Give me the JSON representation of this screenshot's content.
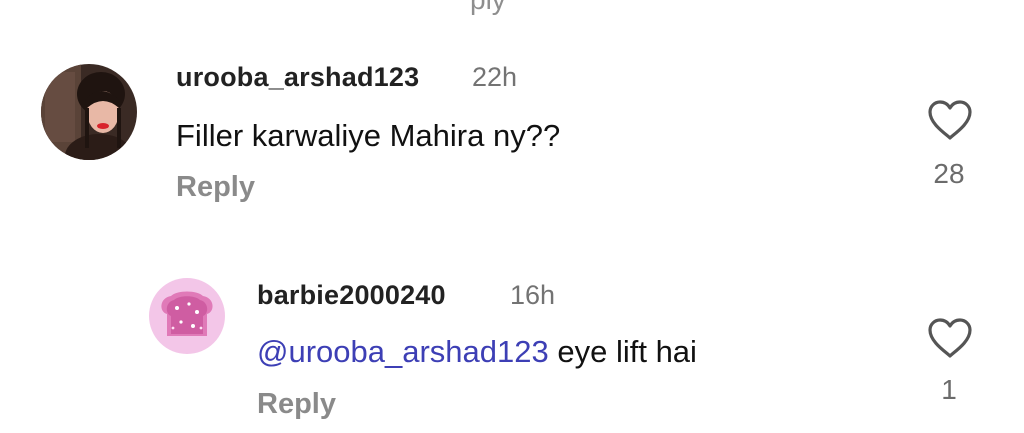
{
  "top_fragment": "ply",
  "comments": [
    {
      "username": "urooba_arshad123",
      "time": "22h",
      "text": "Filler karwaliye Mahira ny??",
      "reply_label": "Reply",
      "like_count": "28",
      "avatar_icon": "user-photo-avatar",
      "heart_icon": "heart-outline-icon"
    }
  ],
  "replies": [
    {
      "username": "barbie2000240",
      "time": "16h",
      "mention": "@urooba_arshad123",
      "text": " eye lift hai",
      "reply_label": "Reply",
      "like_count": "1",
      "avatar_icon": "sparkly-bread-avatar",
      "heart_icon": "heart-outline-icon"
    }
  ],
  "colors": {
    "mention": "#3d3fb5",
    "secondary_text": "#737373",
    "reply_text": "#8a8a8a"
  }
}
